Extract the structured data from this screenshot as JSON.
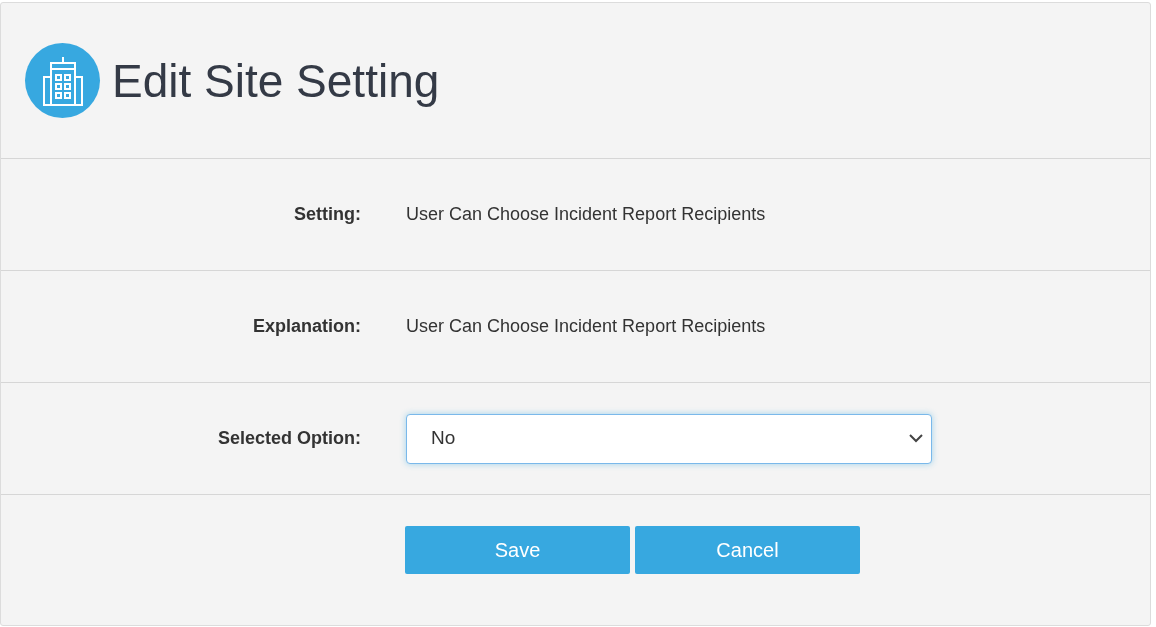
{
  "header": {
    "title": "Edit Site Setting"
  },
  "fields": [
    {
      "kind": "text",
      "label": "Setting:",
      "value": "User Can Choose Incident Report Recipients"
    },
    {
      "kind": "text",
      "label": "Explanation:",
      "value": "User Can Choose Incident Report Recipients"
    },
    {
      "kind": "select",
      "label": "Selected Option:",
      "value": "No",
      "focused": true
    }
  ],
  "buttons": [
    "Save",
    "Cancel"
  ]
}
